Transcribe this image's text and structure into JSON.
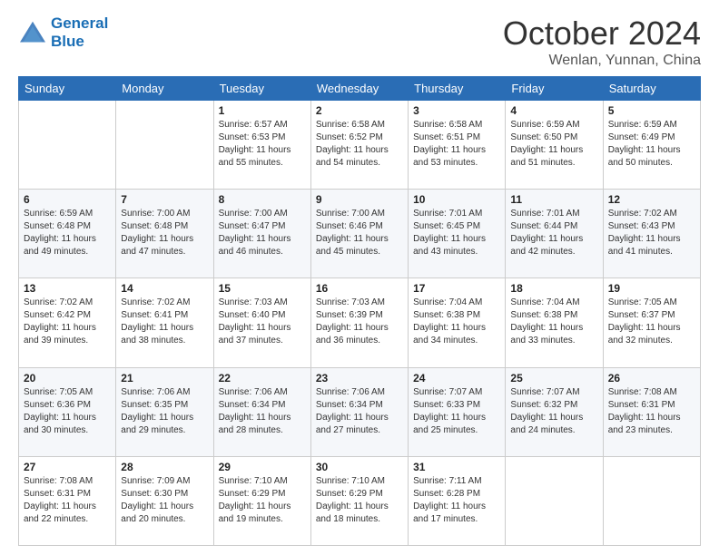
{
  "header": {
    "logo_line1": "General",
    "logo_line2": "Blue",
    "month": "October 2024",
    "location": "Wenlan, Yunnan, China"
  },
  "days_of_week": [
    "Sunday",
    "Monday",
    "Tuesday",
    "Wednesday",
    "Thursday",
    "Friday",
    "Saturday"
  ],
  "weeks": [
    [
      {
        "day": "",
        "sunrise": "",
        "sunset": "",
        "daylight": ""
      },
      {
        "day": "",
        "sunrise": "",
        "sunset": "",
        "daylight": ""
      },
      {
        "day": "1",
        "sunrise": "Sunrise: 6:57 AM",
        "sunset": "Sunset: 6:53 PM",
        "daylight": "Daylight: 11 hours and 55 minutes."
      },
      {
        "day": "2",
        "sunrise": "Sunrise: 6:58 AM",
        "sunset": "Sunset: 6:52 PM",
        "daylight": "Daylight: 11 hours and 54 minutes."
      },
      {
        "day": "3",
        "sunrise": "Sunrise: 6:58 AM",
        "sunset": "Sunset: 6:51 PM",
        "daylight": "Daylight: 11 hours and 53 minutes."
      },
      {
        "day": "4",
        "sunrise": "Sunrise: 6:59 AM",
        "sunset": "Sunset: 6:50 PM",
        "daylight": "Daylight: 11 hours and 51 minutes."
      },
      {
        "day": "5",
        "sunrise": "Sunrise: 6:59 AM",
        "sunset": "Sunset: 6:49 PM",
        "daylight": "Daylight: 11 hours and 50 minutes."
      }
    ],
    [
      {
        "day": "6",
        "sunrise": "Sunrise: 6:59 AM",
        "sunset": "Sunset: 6:48 PM",
        "daylight": "Daylight: 11 hours and 49 minutes."
      },
      {
        "day": "7",
        "sunrise": "Sunrise: 7:00 AM",
        "sunset": "Sunset: 6:48 PM",
        "daylight": "Daylight: 11 hours and 47 minutes."
      },
      {
        "day": "8",
        "sunrise": "Sunrise: 7:00 AM",
        "sunset": "Sunset: 6:47 PM",
        "daylight": "Daylight: 11 hours and 46 minutes."
      },
      {
        "day": "9",
        "sunrise": "Sunrise: 7:00 AM",
        "sunset": "Sunset: 6:46 PM",
        "daylight": "Daylight: 11 hours and 45 minutes."
      },
      {
        "day": "10",
        "sunrise": "Sunrise: 7:01 AM",
        "sunset": "Sunset: 6:45 PM",
        "daylight": "Daylight: 11 hours and 43 minutes."
      },
      {
        "day": "11",
        "sunrise": "Sunrise: 7:01 AM",
        "sunset": "Sunset: 6:44 PM",
        "daylight": "Daylight: 11 hours and 42 minutes."
      },
      {
        "day": "12",
        "sunrise": "Sunrise: 7:02 AM",
        "sunset": "Sunset: 6:43 PM",
        "daylight": "Daylight: 11 hours and 41 minutes."
      }
    ],
    [
      {
        "day": "13",
        "sunrise": "Sunrise: 7:02 AM",
        "sunset": "Sunset: 6:42 PM",
        "daylight": "Daylight: 11 hours and 39 minutes."
      },
      {
        "day": "14",
        "sunrise": "Sunrise: 7:02 AM",
        "sunset": "Sunset: 6:41 PM",
        "daylight": "Daylight: 11 hours and 38 minutes."
      },
      {
        "day": "15",
        "sunrise": "Sunrise: 7:03 AM",
        "sunset": "Sunset: 6:40 PM",
        "daylight": "Daylight: 11 hours and 37 minutes."
      },
      {
        "day": "16",
        "sunrise": "Sunrise: 7:03 AM",
        "sunset": "Sunset: 6:39 PM",
        "daylight": "Daylight: 11 hours and 36 minutes."
      },
      {
        "day": "17",
        "sunrise": "Sunrise: 7:04 AM",
        "sunset": "Sunset: 6:38 PM",
        "daylight": "Daylight: 11 hours and 34 minutes."
      },
      {
        "day": "18",
        "sunrise": "Sunrise: 7:04 AM",
        "sunset": "Sunset: 6:38 PM",
        "daylight": "Daylight: 11 hours and 33 minutes."
      },
      {
        "day": "19",
        "sunrise": "Sunrise: 7:05 AM",
        "sunset": "Sunset: 6:37 PM",
        "daylight": "Daylight: 11 hours and 32 minutes."
      }
    ],
    [
      {
        "day": "20",
        "sunrise": "Sunrise: 7:05 AM",
        "sunset": "Sunset: 6:36 PM",
        "daylight": "Daylight: 11 hours and 30 minutes."
      },
      {
        "day": "21",
        "sunrise": "Sunrise: 7:06 AM",
        "sunset": "Sunset: 6:35 PM",
        "daylight": "Daylight: 11 hours and 29 minutes."
      },
      {
        "day": "22",
        "sunrise": "Sunrise: 7:06 AM",
        "sunset": "Sunset: 6:34 PM",
        "daylight": "Daylight: 11 hours and 28 minutes."
      },
      {
        "day": "23",
        "sunrise": "Sunrise: 7:06 AM",
        "sunset": "Sunset: 6:34 PM",
        "daylight": "Daylight: 11 hours and 27 minutes."
      },
      {
        "day": "24",
        "sunrise": "Sunrise: 7:07 AM",
        "sunset": "Sunset: 6:33 PM",
        "daylight": "Daylight: 11 hours and 25 minutes."
      },
      {
        "day": "25",
        "sunrise": "Sunrise: 7:07 AM",
        "sunset": "Sunset: 6:32 PM",
        "daylight": "Daylight: 11 hours and 24 minutes."
      },
      {
        "day": "26",
        "sunrise": "Sunrise: 7:08 AM",
        "sunset": "Sunset: 6:31 PM",
        "daylight": "Daylight: 11 hours and 23 minutes."
      }
    ],
    [
      {
        "day": "27",
        "sunrise": "Sunrise: 7:08 AM",
        "sunset": "Sunset: 6:31 PM",
        "daylight": "Daylight: 11 hours and 22 minutes."
      },
      {
        "day": "28",
        "sunrise": "Sunrise: 7:09 AM",
        "sunset": "Sunset: 6:30 PM",
        "daylight": "Daylight: 11 hours and 20 minutes."
      },
      {
        "day": "29",
        "sunrise": "Sunrise: 7:10 AM",
        "sunset": "Sunset: 6:29 PM",
        "daylight": "Daylight: 11 hours and 19 minutes."
      },
      {
        "day": "30",
        "sunrise": "Sunrise: 7:10 AM",
        "sunset": "Sunset: 6:29 PM",
        "daylight": "Daylight: 11 hours and 18 minutes."
      },
      {
        "day": "31",
        "sunrise": "Sunrise: 7:11 AM",
        "sunset": "Sunset: 6:28 PM",
        "daylight": "Daylight: 11 hours and 17 minutes."
      },
      {
        "day": "",
        "sunrise": "",
        "sunset": "",
        "daylight": ""
      },
      {
        "day": "",
        "sunrise": "",
        "sunset": "",
        "daylight": ""
      }
    ]
  ]
}
